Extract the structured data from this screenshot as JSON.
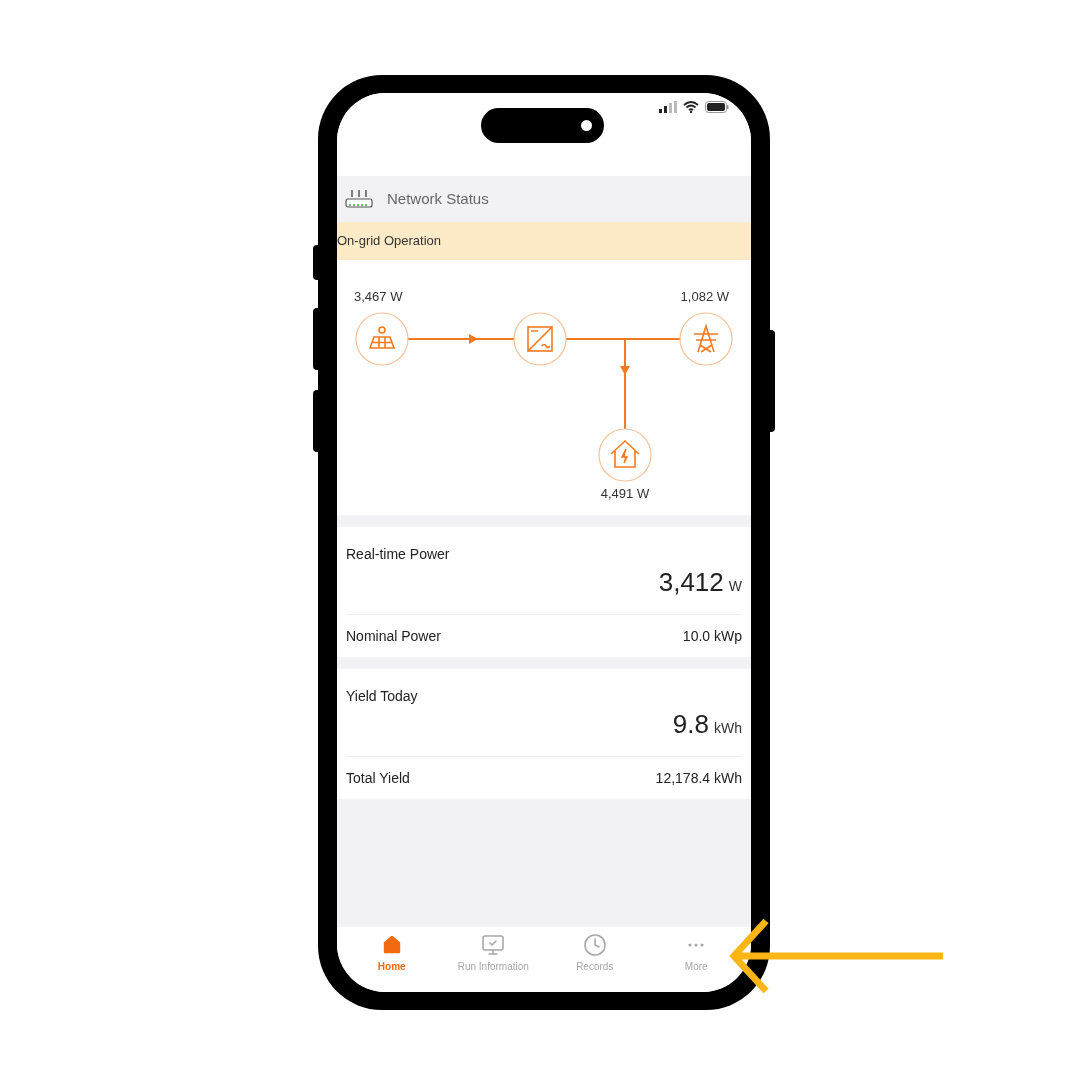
{
  "section_header": {
    "title": "Network Status"
  },
  "status_banner": {
    "text": "On-grid Operation"
  },
  "flow_diagram": {
    "nodes": [
      {
        "kind": "solar",
        "reading": "3,467 W"
      },
      {
        "kind": "inverter"
      },
      {
        "kind": "grid",
        "reading": "1,082 W"
      },
      {
        "kind": "home",
        "reading": "4,491 W"
      }
    ]
  },
  "cards": [
    {
      "rows": [
        {
          "kind": "large",
          "label": "Real-time Power",
          "value": "3,412",
          "unit": "W"
        },
        {
          "kind": "small",
          "label": "Nominal Power",
          "value": "10.0 kWp"
        }
      ]
    },
    {
      "rows": [
        {
          "kind": "large",
          "label": "Yield Today",
          "value": "9.8",
          "unit": "kWh"
        },
        {
          "kind": "small",
          "label": "Total Yield",
          "value": "12,178.4 kWh"
        }
      ]
    }
  ],
  "tab_bar": [
    {
      "kind": "home",
      "label": "Home",
      "selected": true
    },
    {
      "kind": "run",
      "label": "Run Information",
      "selected": false
    },
    {
      "kind": "records",
      "label": "Records",
      "selected": false
    },
    {
      "kind": "more",
      "label": "More",
      "selected": false
    }
  ]
}
